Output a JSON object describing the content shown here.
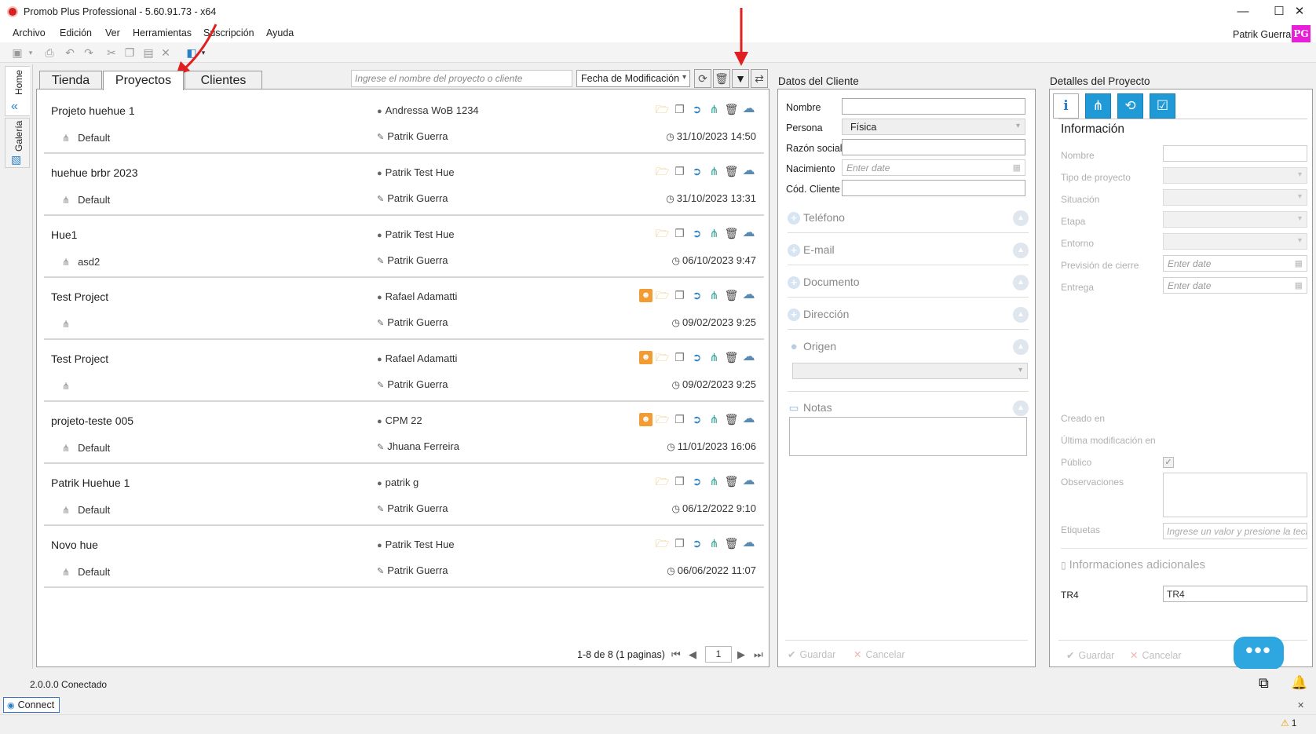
{
  "window": {
    "title": "Promob Plus Professional - 5.60.91.73 - x64",
    "minimize": "—",
    "maximize": "☐",
    "close": "✕"
  },
  "menu": [
    "Archivo",
    "Edición",
    "Ver",
    "Herramientas",
    "Suscripción",
    "Ayuda"
  ],
  "user": {
    "name": "Patrik Guerra",
    "initials": "PG",
    "avatar_color": "#e91ed8"
  },
  "side_tabs": [
    "Home",
    "Galería"
  ],
  "tabs": [
    "Tienda",
    "Proyectos",
    "Clientes"
  ],
  "active_tab": "Proyectos",
  "search": {
    "placeholder": "Ingrese el nombre del proyecto o cliente",
    "value": ""
  },
  "sort": {
    "value": "Fecha de Modificación"
  },
  "projects": [
    {
      "name": "Projeto huehue 1",
      "branch": "Default",
      "owner": "Andressa WoB 1234",
      "author": "Patrik Guerra",
      "date": "31/10/2023 14:50",
      "has_person": false
    },
    {
      "name": "huehue brbr 2023",
      "branch": "Default",
      "owner": "Patrik Test Hue",
      "author": "Patrik Guerra",
      "date": "31/10/2023 13:31",
      "has_person": false
    },
    {
      "name": "Hue1",
      "branch": "asd2",
      "owner": "Patrik Test Hue",
      "author": "Patrik Guerra",
      "date": "06/10/2023 9:47",
      "has_person": false
    },
    {
      "name": "Test Project",
      "branch": "",
      "owner": "Rafael Adamatti",
      "author": "Patrik Guerra",
      "date": "09/02/2023 9:25",
      "has_person": true
    },
    {
      "name": "Test Project",
      "branch": "",
      "owner": "Rafael Adamatti",
      "author": "Patrik Guerra",
      "date": "09/02/2023 9:25",
      "has_person": true
    },
    {
      "name": "projeto-teste 005",
      "branch": "Default",
      "owner": "CPM 22",
      "author": "Jhuana Ferreira",
      "date": "11/01/2023 16:06",
      "has_person": true
    },
    {
      "name": "Patrik Huehue 1",
      "branch": "Default",
      "owner": "patrik g",
      "author": "Patrik Guerra",
      "date": "06/12/2022 9:10",
      "has_person": false
    },
    {
      "name": "Novo hue",
      "branch": "Default",
      "owner": "Patrik Test Hue",
      "author": "Patrik Guerra",
      "date": "06/06/2022 11:07",
      "has_person": false
    }
  ],
  "pager": {
    "text": "1-8 de 8 (1 paginas)",
    "page": "1"
  },
  "client": {
    "title": "Datos del Cliente",
    "labels": {
      "nombre": "Nombre",
      "persona": "Persona",
      "razon": "Razón social",
      "nacimiento": "Nacimiento",
      "cod": "Cód. Cliente"
    },
    "persona_value": "Física",
    "date_placeholder": "Enter date",
    "sections": [
      "Teléfono",
      "E-mail",
      "Documento",
      "Dirección",
      "Origen"
    ],
    "notas": "Notas",
    "save": "Guardar",
    "cancel": "Cancelar"
  },
  "details": {
    "title": "Detalles del Proyecto",
    "info_heading": "Información",
    "labels": [
      "Nombre",
      "Tipo de proyecto",
      "Situación",
      "Etapa",
      "Entorno",
      "Previsión de cierre",
      "Entrega"
    ],
    "date_placeholder": "Enter date",
    "creado": "Creado en",
    "ultima": "Última modificación en",
    "publico": "Público",
    "observaciones": "Observaciones",
    "etiquetas": "Etiquetas",
    "etiquetas_placeholder": "Ingrese un valor y presione la tecla",
    "adicionales": "Informaciones adicionales",
    "tr4_label": "TR4",
    "tr4_value": "TR4",
    "save": "Guardar",
    "cancel": "Cancelar"
  },
  "status": {
    "version": "2.0.0.0",
    "state": "Conectado",
    "connect": "Connect",
    "warnings": "1"
  },
  "colors": {
    "accent": "#2a7fc7",
    "annotation": "#e02020"
  }
}
